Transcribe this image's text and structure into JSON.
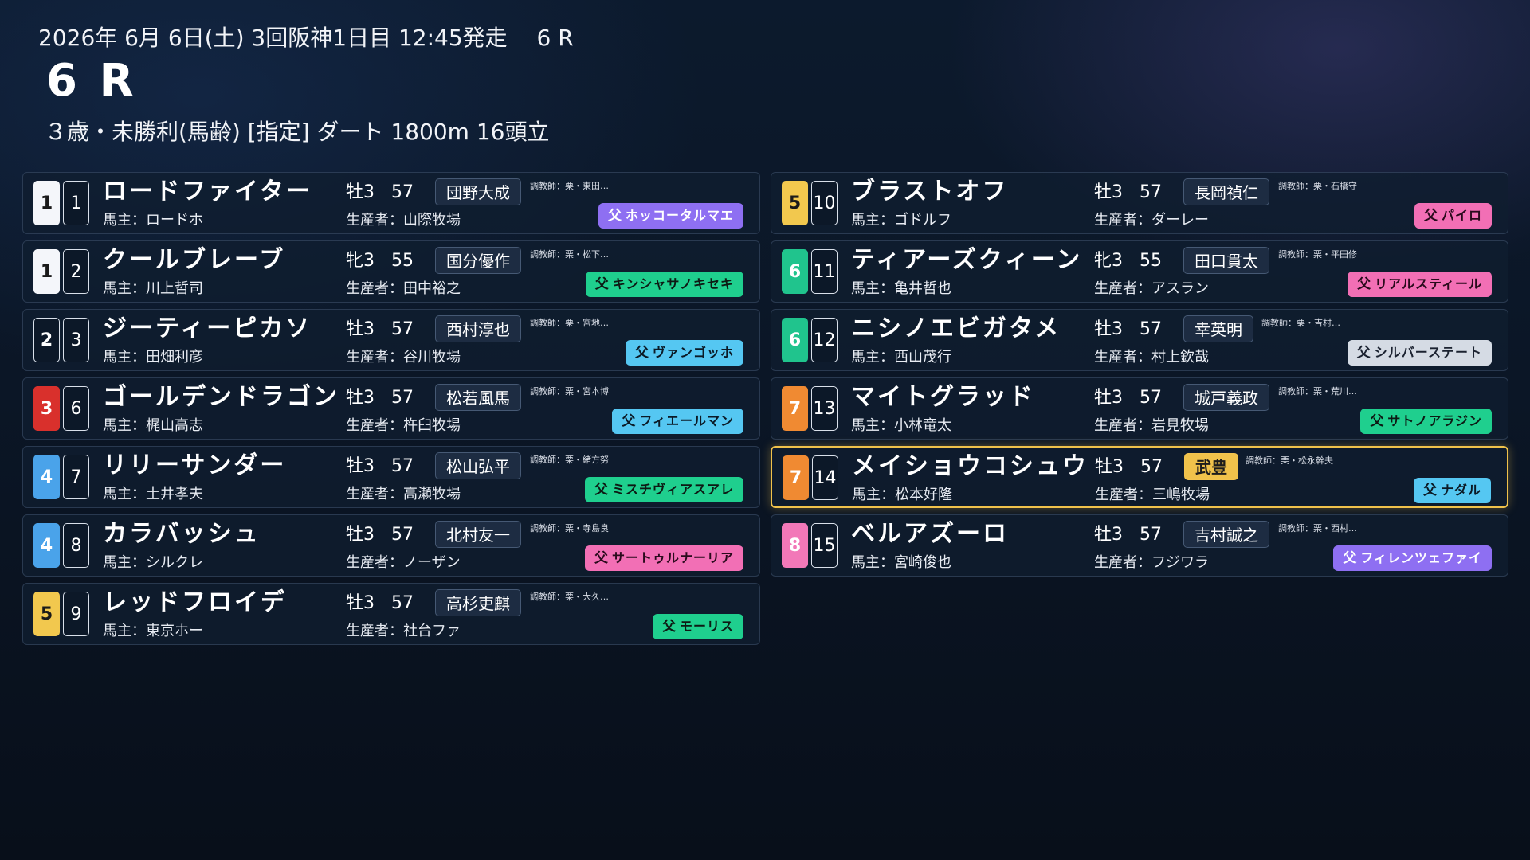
{
  "header": {
    "meta": "2026年 6月 6日(土) 3回阪神1日目 12:45発走　 6 R",
    "race": "6 R",
    "condition": "３歳・未勝利(馬齢) [指定] ダート 1800m  16頭立"
  },
  "colors": {
    "frame_1": "#f4f6fa",
    "frame_2": "#0c1828",
    "frame_3": "#d9302c",
    "frame_4": "#4aa3ea",
    "frame_5": "#f2c84e",
    "frame_6": "#20c48d",
    "frame_7": "#f08a32",
    "frame_8": "#f278b8",
    "highlight": "#f0c24b"
  },
  "entries": [
    {
      "frame": "1",
      "number": "1",
      "name": "ロードファイター",
      "sex_age": "牡3",
      "weight": "57",
      "jockey": "団野大成",
      "trainer": "調教師：栗・東田…",
      "owner": "馬主：ロードホ",
      "breeder": "生産者：山際牧場",
      "sire_prefix": "父",
      "sire": "ホッコータルマエ",
      "sire_color": "#8e6ff2",
      "sire_text": "#ffffff"
    },
    {
      "frame": "1",
      "number": "2",
      "name": "クールブレーブ",
      "sex_age": "牝3",
      "weight": "55",
      "jockey": "国分優作",
      "trainer": "調教師：栗・松下…",
      "owner": "馬主：川上哲司",
      "breeder": "生産者：田中裕之",
      "sire_prefix": "父",
      "sire": "キンシャサノキセキ",
      "sire_color": "#1fcf8e",
      "sire_text": "#0d1a14"
    },
    {
      "frame": "2",
      "number": "3",
      "name": "ジーティーピカソ",
      "sex_age": "牡3",
      "weight": "57",
      "jockey": "西村淳也",
      "trainer": "調教師：栗・宮地…",
      "owner": "馬主：田畑利彦",
      "breeder": "生産者：谷川牧場",
      "sire_prefix": "父",
      "sire": "ヴァンゴッホ",
      "sire_color": "#55c7f2",
      "sire_text": "#0b1a26"
    },
    {
      "frame": "3",
      "number": "6",
      "name": "ゴールデンドラゴン",
      "sex_age": "牡3",
      "weight": "57",
      "jockey": "松若風馬",
      "trainer": "調教師：栗・宮本博",
      "owner": "馬主：梶山高志",
      "breeder": "生産者：杵臼牧場",
      "sire_prefix": "父",
      "sire": "フィエールマン",
      "sire_color": "#55c7f2",
      "sire_text": "#0b1a26"
    },
    {
      "frame": "4",
      "number": "7",
      "name": "リリーサンダー",
      "sex_age": "牡3",
      "weight": "57",
      "jockey": "松山弘平",
      "trainer": "調教師：栗・緒方努",
      "owner": "馬主：土井孝夫",
      "breeder": "生産者：高瀬牧場",
      "sire_prefix": "父",
      "sire": "ミスチヴィアスアレ",
      "sire_color": "#1fcf8e",
      "sire_text": "#0d1a14"
    },
    {
      "frame": "4",
      "number": "8",
      "name": "カラバッシュ",
      "sex_age": "牡3",
      "weight": "57",
      "jockey": "北村友一",
      "trainer": "調教師：栗・寺島良",
      "owner": "馬主：シルクレ",
      "breeder": "生産者：ノーザン",
      "sire_prefix": "父",
      "sire": "サートゥルナーリア",
      "sire_color": "#f26fb5",
      "sire_text": "#2a0a1c"
    },
    {
      "frame": "5",
      "number": "9",
      "name": "レッドフロイデ",
      "sex_age": "牡3",
      "weight": "57",
      "jockey": "高杉吏麒",
      "trainer": "調教師：栗・大久…",
      "owner": "馬主：東京ホー",
      "breeder": "生産者：社台ファ",
      "sire_prefix": "父",
      "sire": "モーリス",
      "sire_color": "#1fcf8e",
      "sire_text": "#0d1a14"
    },
    {
      "frame": "5",
      "number": "10",
      "name": "ブラストオフ",
      "sex_age": "牡3",
      "weight": "57",
      "jockey": "長岡禎仁",
      "trainer": "調教師：栗・石橋守",
      "owner": "馬主：ゴドルフ",
      "breeder": "生産者：ダーレー",
      "sire_prefix": "父",
      "sire": "パイロ",
      "sire_color": "#f26fb5",
      "sire_text": "#2a0a1c"
    },
    {
      "frame": "6",
      "number": "11",
      "name": "ティアーズクィーン",
      "sex_age": "牝3",
      "weight": "55",
      "jockey": "田口貫太",
      "trainer": "調教師：栗・平田修",
      "owner": "馬主：亀井哲也",
      "breeder": "生産者：アスラン",
      "sire_prefix": "父",
      "sire": "リアルスティール",
      "sire_color": "#f26fb5",
      "sire_text": "#2a0a1c"
    },
    {
      "frame": "6",
      "number": "12",
      "name": "ニシノエビガタメ",
      "sex_age": "牡3",
      "weight": "57",
      "jockey": "幸英明",
      "trainer": "調教師：栗・吉村…",
      "owner": "馬主：西山茂行",
      "breeder": "生産者：村上欽哉",
      "sire_prefix": "父",
      "sire": "シルバーステート",
      "sire_color": "#d5dbe4",
      "sire_text": "#1b2230"
    },
    {
      "frame": "7",
      "number": "13",
      "name": "マイトグラッド",
      "sex_age": "牡3",
      "weight": "57",
      "jockey": "城戸義政",
      "trainer": "調教師：栗・荒川…",
      "owner": "馬主：小林竜太",
      "breeder": "生産者：岩見牧場",
      "sire_prefix": "父",
      "sire": "サトノアラジン",
      "sire_color": "#1fcf8e",
      "sire_text": "#0d1a14"
    },
    {
      "frame": "7",
      "number": "14",
      "name": "メイショウコシュウ",
      "sex_age": "牡3",
      "weight": "57",
      "jockey": "武豊",
      "trainer": "調教師：栗・松永幹夫",
      "owner": "馬主：松本好隆",
      "breeder": "生産者：三嶋牧場",
      "sire_prefix": "父",
      "sire": "ナダル",
      "sire_color": "#55c7f2",
      "sire_text": "#0b1a26",
      "highlight": true
    },
    {
      "frame": "8",
      "number": "15",
      "name": "ベルアズーロ",
      "sex_age": "牡3",
      "weight": "57",
      "jockey": "吉村誠之",
      "trainer": "調教師：栗・西村…",
      "owner": "馬主：宮崎俊也",
      "breeder": "生産者：フジワラ",
      "sire_prefix": "父",
      "sire": "フィレンツェファイ",
      "sire_color": "#8e6ff2",
      "sire_text": "#ffffff"
    }
  ]
}
